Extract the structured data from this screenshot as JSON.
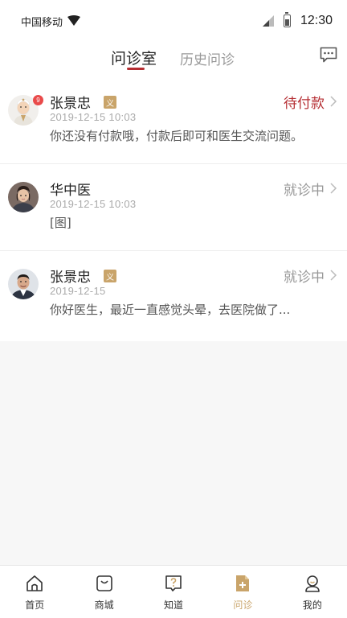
{
  "status_bar": {
    "carrier": "中国移动",
    "time": "12:30"
  },
  "header": {
    "tabs": [
      {
        "label": "问诊室",
        "active": true
      },
      {
        "label": "历史问诊",
        "active": false
      }
    ],
    "chat_icon": "message-bubble-icon"
  },
  "consultations": [
    {
      "name": "张景忠",
      "tag": "义",
      "badge": "9",
      "datetime": "2019-12-15  10:03",
      "message": "你还没有付款哦，付款后即可和医生交流问题。",
      "status": "待付款",
      "avatar": "elderly-doctor-avatar"
    },
    {
      "name": "华中医",
      "tag": "",
      "badge": "",
      "datetime": "2019-12-15  10:03",
      "message": "[图]",
      "status": "就诊中",
      "avatar": "doctor-photo-avatar"
    },
    {
      "name": "张景忠",
      "tag": "义",
      "badge": "",
      "datetime": "2019-12-15",
      "message": "你好医生，最近一直感觉头晕，去医院做了...",
      "status": "就诊中",
      "avatar": "doctor-photo-avatar"
    }
  ],
  "tabbar": {
    "items": [
      {
        "label": "首页",
        "icon": "home-icon",
        "active": false
      },
      {
        "label": "商城",
        "icon": "shop-bag-icon",
        "active": false
      },
      {
        "label": "知道",
        "icon": "question-icon",
        "active": false
      },
      {
        "label": "问诊",
        "icon": "consult-doc-icon",
        "active": true
      },
      {
        "label": "我的",
        "icon": "profile-icon",
        "active": false
      }
    ]
  },
  "colors": {
    "accent_red": "#b52d32",
    "accent_gold": "#c9a46a",
    "badge_red": "#e94a4a"
  }
}
